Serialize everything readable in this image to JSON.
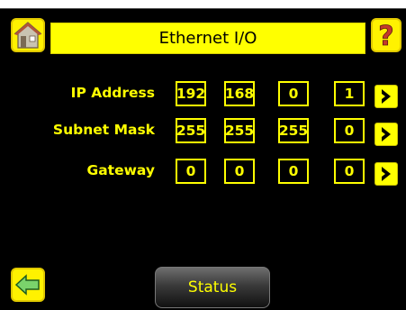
{
  "header": {
    "title": "Ethernet I/O",
    "home_icon": "home-icon",
    "help_icon": "help-question-icon",
    "help_glyph": "?"
  },
  "rows": [
    {
      "label": "IP Address",
      "octets": [
        "192",
        "168",
        "0",
        "1"
      ]
    },
    {
      "label": "Subnet Mask",
      "octets": [
        "255",
        "255",
        "255",
        "0"
      ]
    },
    {
      "label": "Gateway",
      "octets": [
        "0",
        "0",
        "0",
        "0"
      ]
    }
  ],
  "footer": {
    "status_label": "Status",
    "back_icon": "back-arrow-icon"
  },
  "colors": {
    "accent": "#ffff00",
    "background": "#000000"
  }
}
